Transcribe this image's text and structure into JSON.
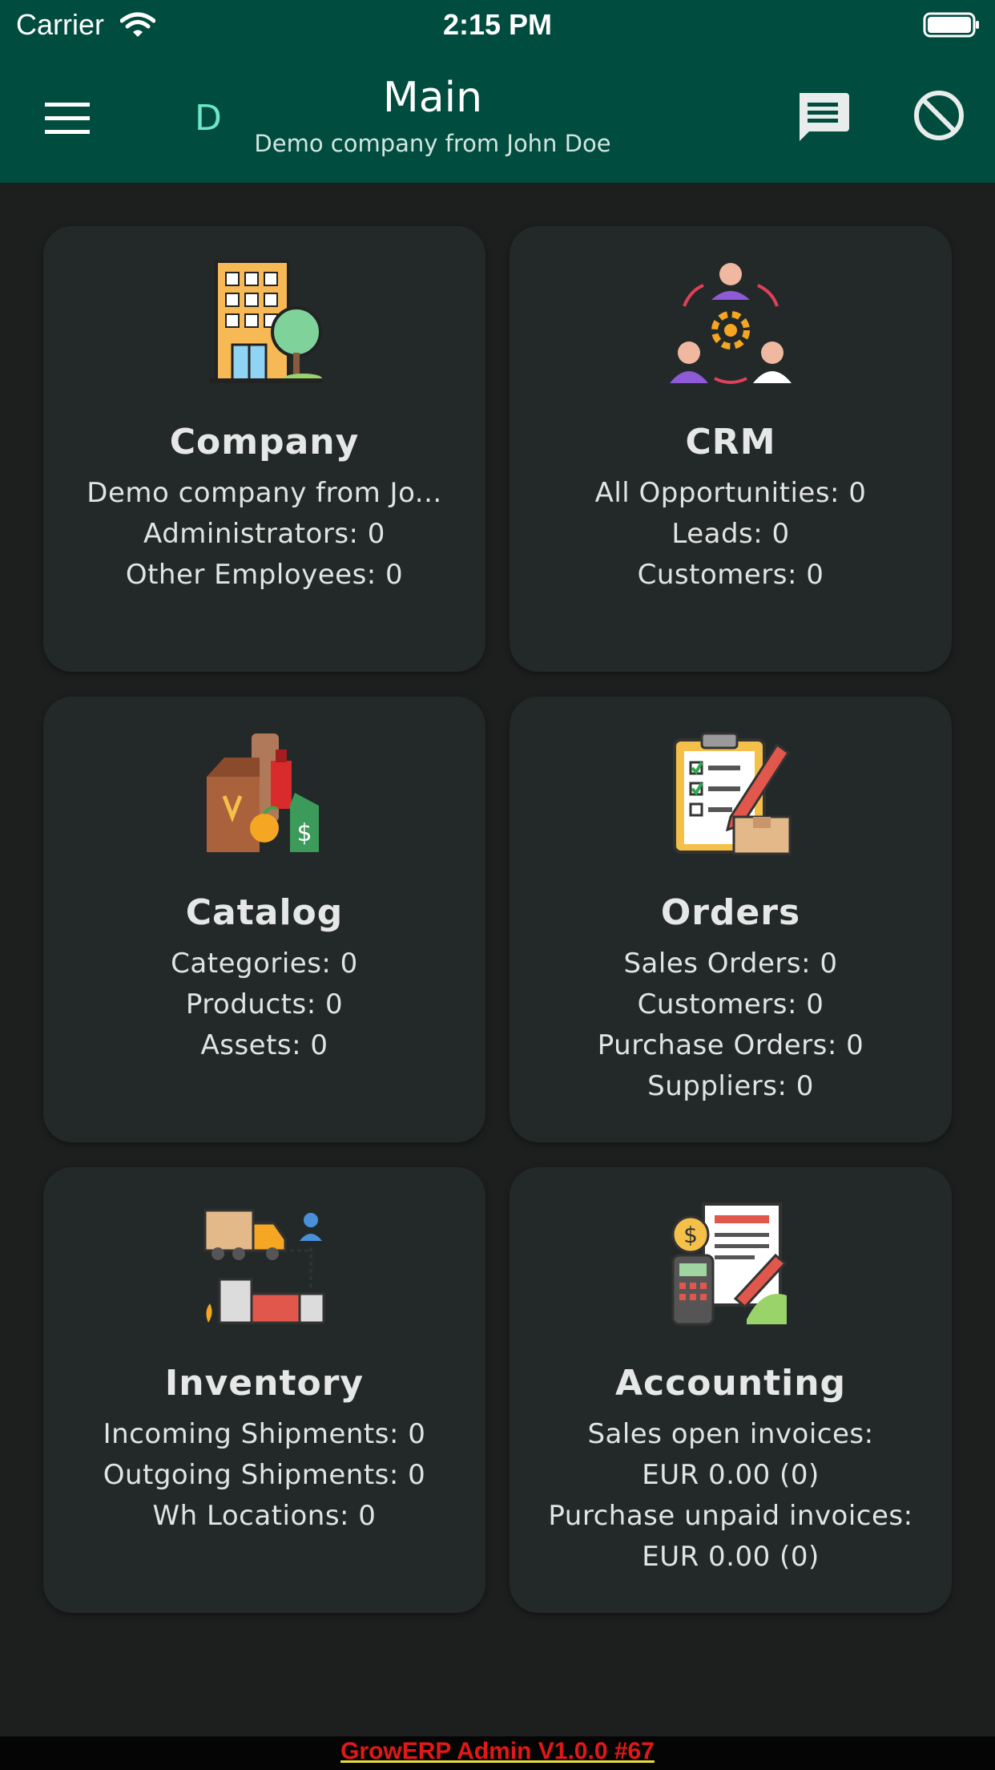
{
  "status_bar": {
    "carrier": "Carrier",
    "time": "2:15 PM"
  },
  "app_bar": {
    "avatar_letter": "D",
    "title": "Main",
    "subtitle": "Demo company from John Doe"
  },
  "cards": [
    {
      "title": "Company",
      "icon": "company-building-icon",
      "lines": [
        "Demo company from Jo...",
        "Administrators: 0",
        "Other Employees: 0"
      ]
    },
    {
      "title": "CRM",
      "icon": "crm-people-icon",
      "lines": [
        "All Opportunities: 0",
        "Leads: 0",
        "Customers: 0"
      ]
    },
    {
      "title": "Catalog",
      "icon": "catalog-products-icon",
      "lines": [
        "Categories: 0",
        "Products: 0",
        "Assets: 0"
      ]
    },
    {
      "title": "Orders",
      "icon": "orders-clipboard-icon",
      "lines": [
        "Sales Orders: 0",
        "Customers: 0",
        "Purchase Orders: 0",
        "Suppliers: 0"
      ]
    },
    {
      "title": "Inventory",
      "icon": "inventory-truck-icon",
      "lines": [
        "Incoming Shipments: 0",
        "Outgoing Shipments: 0",
        "Wh Locations: 0"
      ]
    },
    {
      "title": "Accounting",
      "icon": "accounting-invoice-icon",
      "lines": [
        "Sales open invoices:",
        "EUR 0.00 (0)",
        "Purchase unpaid invoices:",
        "EUR 0.00 (0)"
      ]
    }
  ],
  "footer": {
    "version_text": "GrowERP Admin V1.0.0 #67"
  },
  "colors": {
    "app_bar": "#004c3f",
    "background": "#1c1f1e",
    "card": "#232928",
    "accent": "#6ee7c8"
  }
}
